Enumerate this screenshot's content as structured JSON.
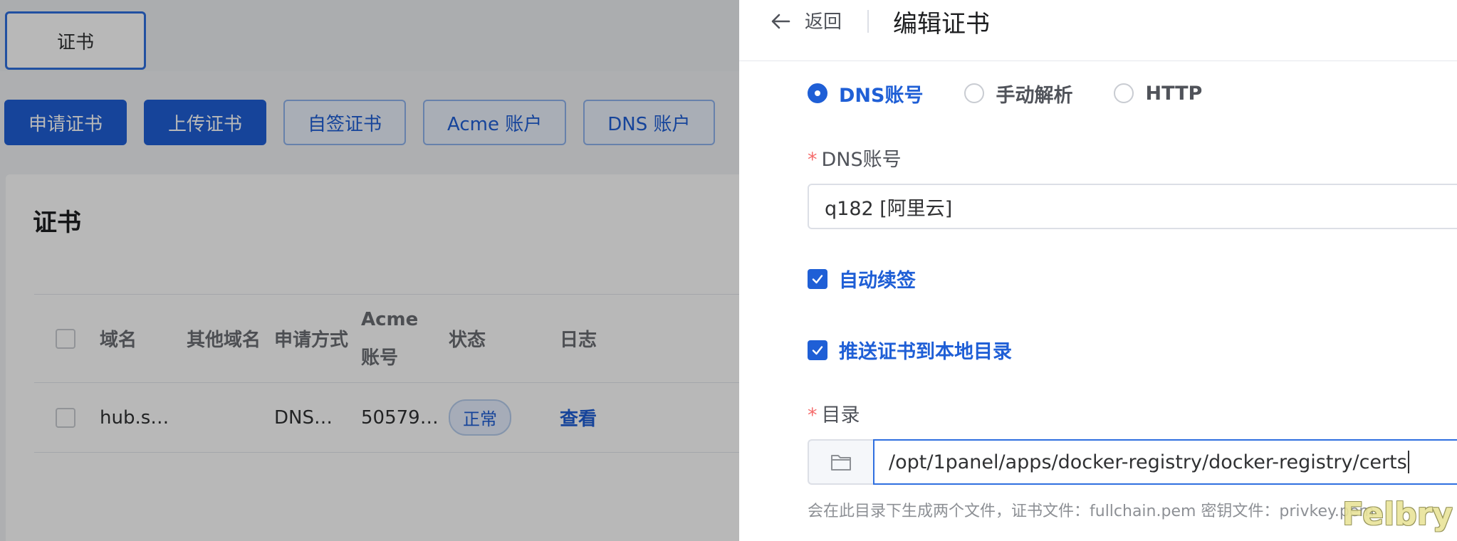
{
  "background": {
    "top_tab": "证书",
    "actions": [
      "申请证书",
      "上传证书",
      "自签证书",
      "Acme 账户",
      "DNS 账户"
    ],
    "card_title": "证书",
    "table": {
      "headers": [
        "域名",
        "其他域名",
        "申请方式",
        "Acme 账号",
        "状态",
        "日志"
      ],
      "acme_header_line1": "Acme",
      "acme_header_line2": "账号",
      "row": {
        "domain": "hub.s…",
        "other_domains": "",
        "method": "DNS…",
        "acme_account": "50579…",
        "status": "正常",
        "log": "查看"
      }
    }
  },
  "drawer": {
    "back_label": "返回",
    "title": "编辑证书",
    "verify_options": [
      {
        "label": "DNS账号",
        "selected": true
      },
      {
        "label": "手动解析",
        "selected": false
      },
      {
        "label": "HTTP",
        "selected": false
      }
    ],
    "dns_account_label": "DNS账号",
    "dns_account_value": "q182 [阿里云]",
    "auto_renew_label": "自动续签",
    "auto_renew_checked": true,
    "push_dir_label": "推送证书到本地目录",
    "push_dir_checked": true,
    "dir_label": "目录",
    "dir_value": "/opt/1panel/apps/docker-registry/docker-registry/certs",
    "dir_hint": "会在此目录下生成两个文件，证书文件：fullchain.pem 密钥文件：privkey.pem"
  },
  "watermark": "Felbry",
  "colors": {
    "primary": "#1f5fd6",
    "required": "#f56c6c"
  }
}
